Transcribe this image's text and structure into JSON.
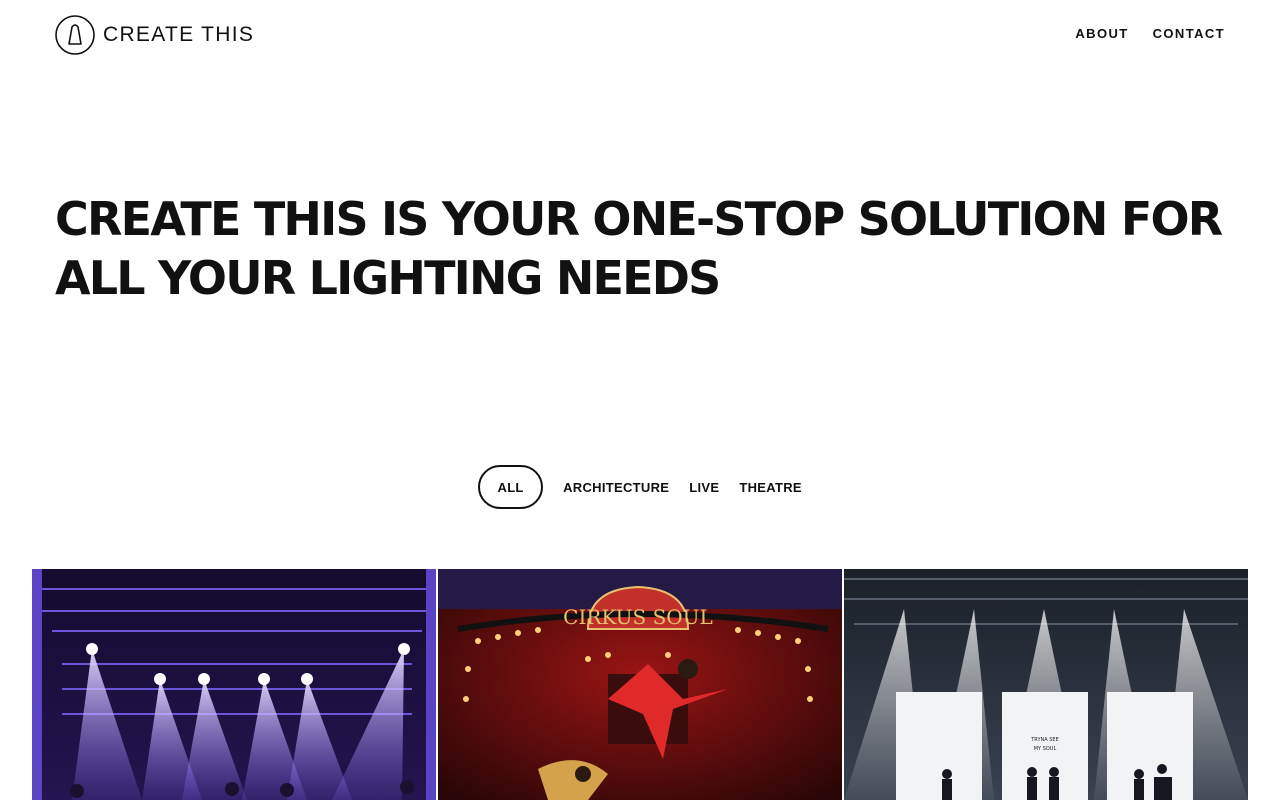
{
  "brand": {
    "name": "CREATE THIS",
    "logo_icon": "bell-outline-circle-icon"
  },
  "nav": {
    "items": [
      {
        "label": "ABOUT"
      },
      {
        "label": "CONTACT"
      }
    ]
  },
  "hero": {
    "headline": "CREATE THIS IS YOUR ONE-STOP SOLUTION FOR ALL YOUR LIGHTING NEEDS"
  },
  "filters": {
    "active": "ALL",
    "items": [
      {
        "label": "ALL"
      },
      {
        "label": "ARCHITECTURE"
      },
      {
        "label": "LIVE"
      },
      {
        "label": "THEATRE"
      }
    ]
  },
  "projects": {
    "items": [
      {
        "image": "purple-stage-light-beams",
        "accent": "#7b5cf0"
      },
      {
        "image": "circus-soul-acrobat-dancers",
        "accent": "#c8201e",
        "sign_text": "CIRKUS SOUL"
      },
      {
        "image": "concert-stage-white-screens",
        "accent": "#9aa6b8",
        "screen_text": [
          "TRYNA SEE",
          "MY SOUL"
        ]
      }
    ]
  },
  "colors": {
    "text": "#111111",
    "background": "#ffffff"
  }
}
